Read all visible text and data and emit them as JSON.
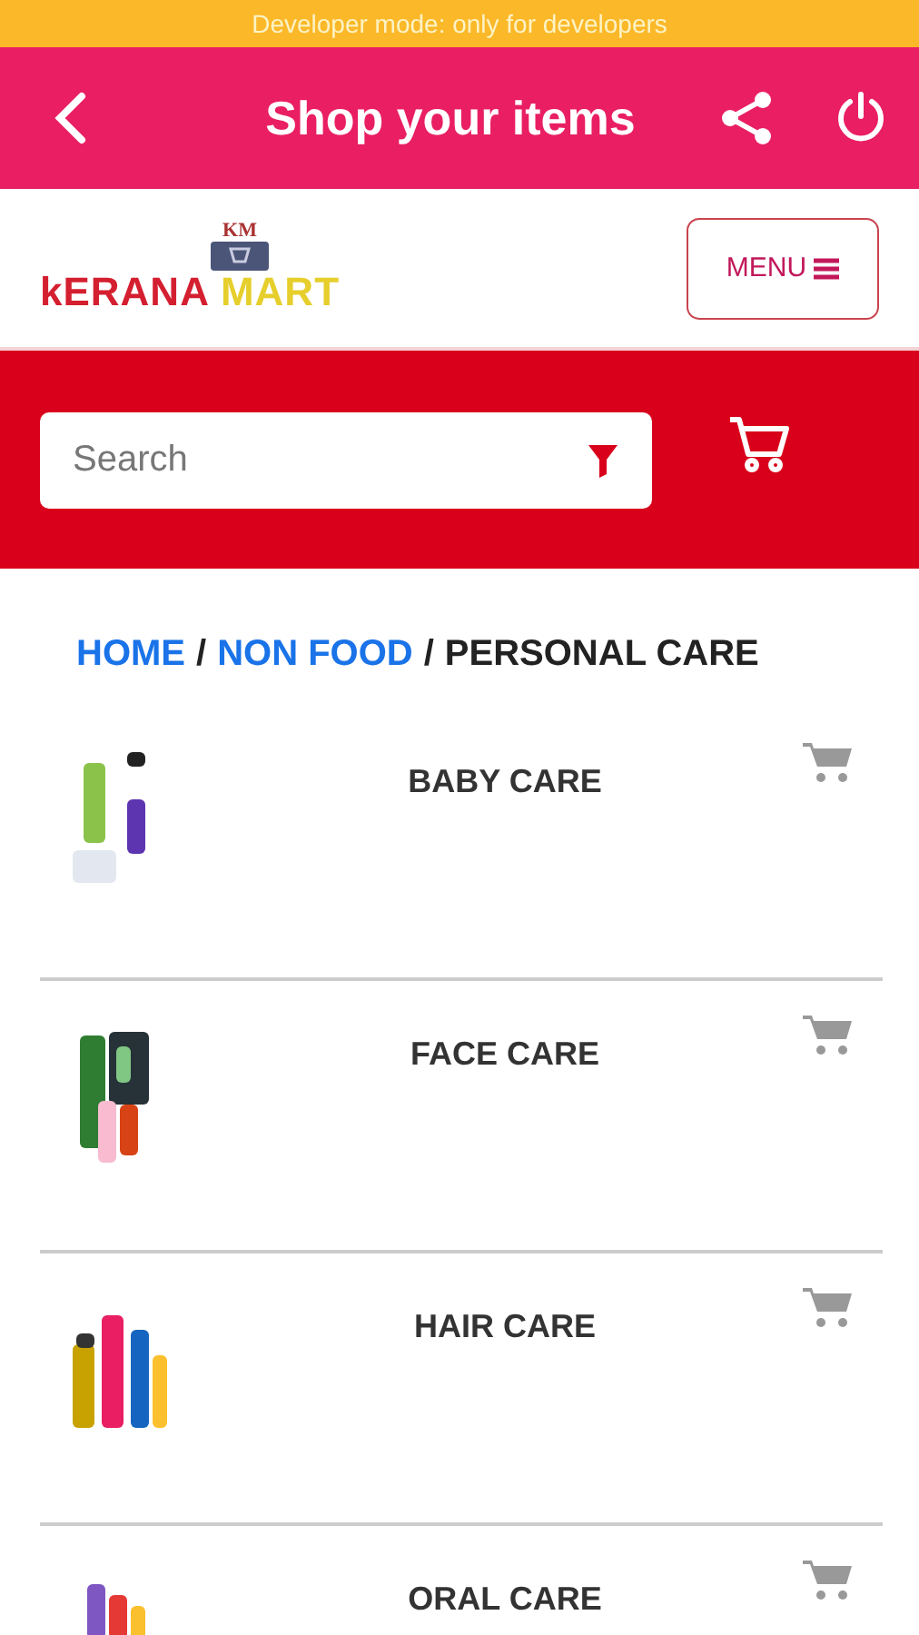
{
  "status_banner": {
    "text": "Developer mode: only for developers"
  },
  "app_bar": {
    "title": "Shop your items"
  },
  "brand": {
    "mark": "KM",
    "name_1": "kERANA",
    "name_2": "MART"
  },
  "menu_button": {
    "label": "MENU"
  },
  "search": {
    "placeholder": "Search"
  },
  "breadcrumb": [
    {
      "label": "HOME",
      "link": true
    },
    {
      "prefix": "/",
      "label": "NON FOOD",
      "link": true
    },
    {
      "prefix": "/",
      "label": "PERSONAL CARE",
      "link": false
    }
  ],
  "categories": [
    {
      "name": "BABY CARE"
    },
    {
      "name": "FACE CARE"
    },
    {
      "name": "HAIR CARE"
    },
    {
      "name": "ORAL CARE"
    }
  ]
}
